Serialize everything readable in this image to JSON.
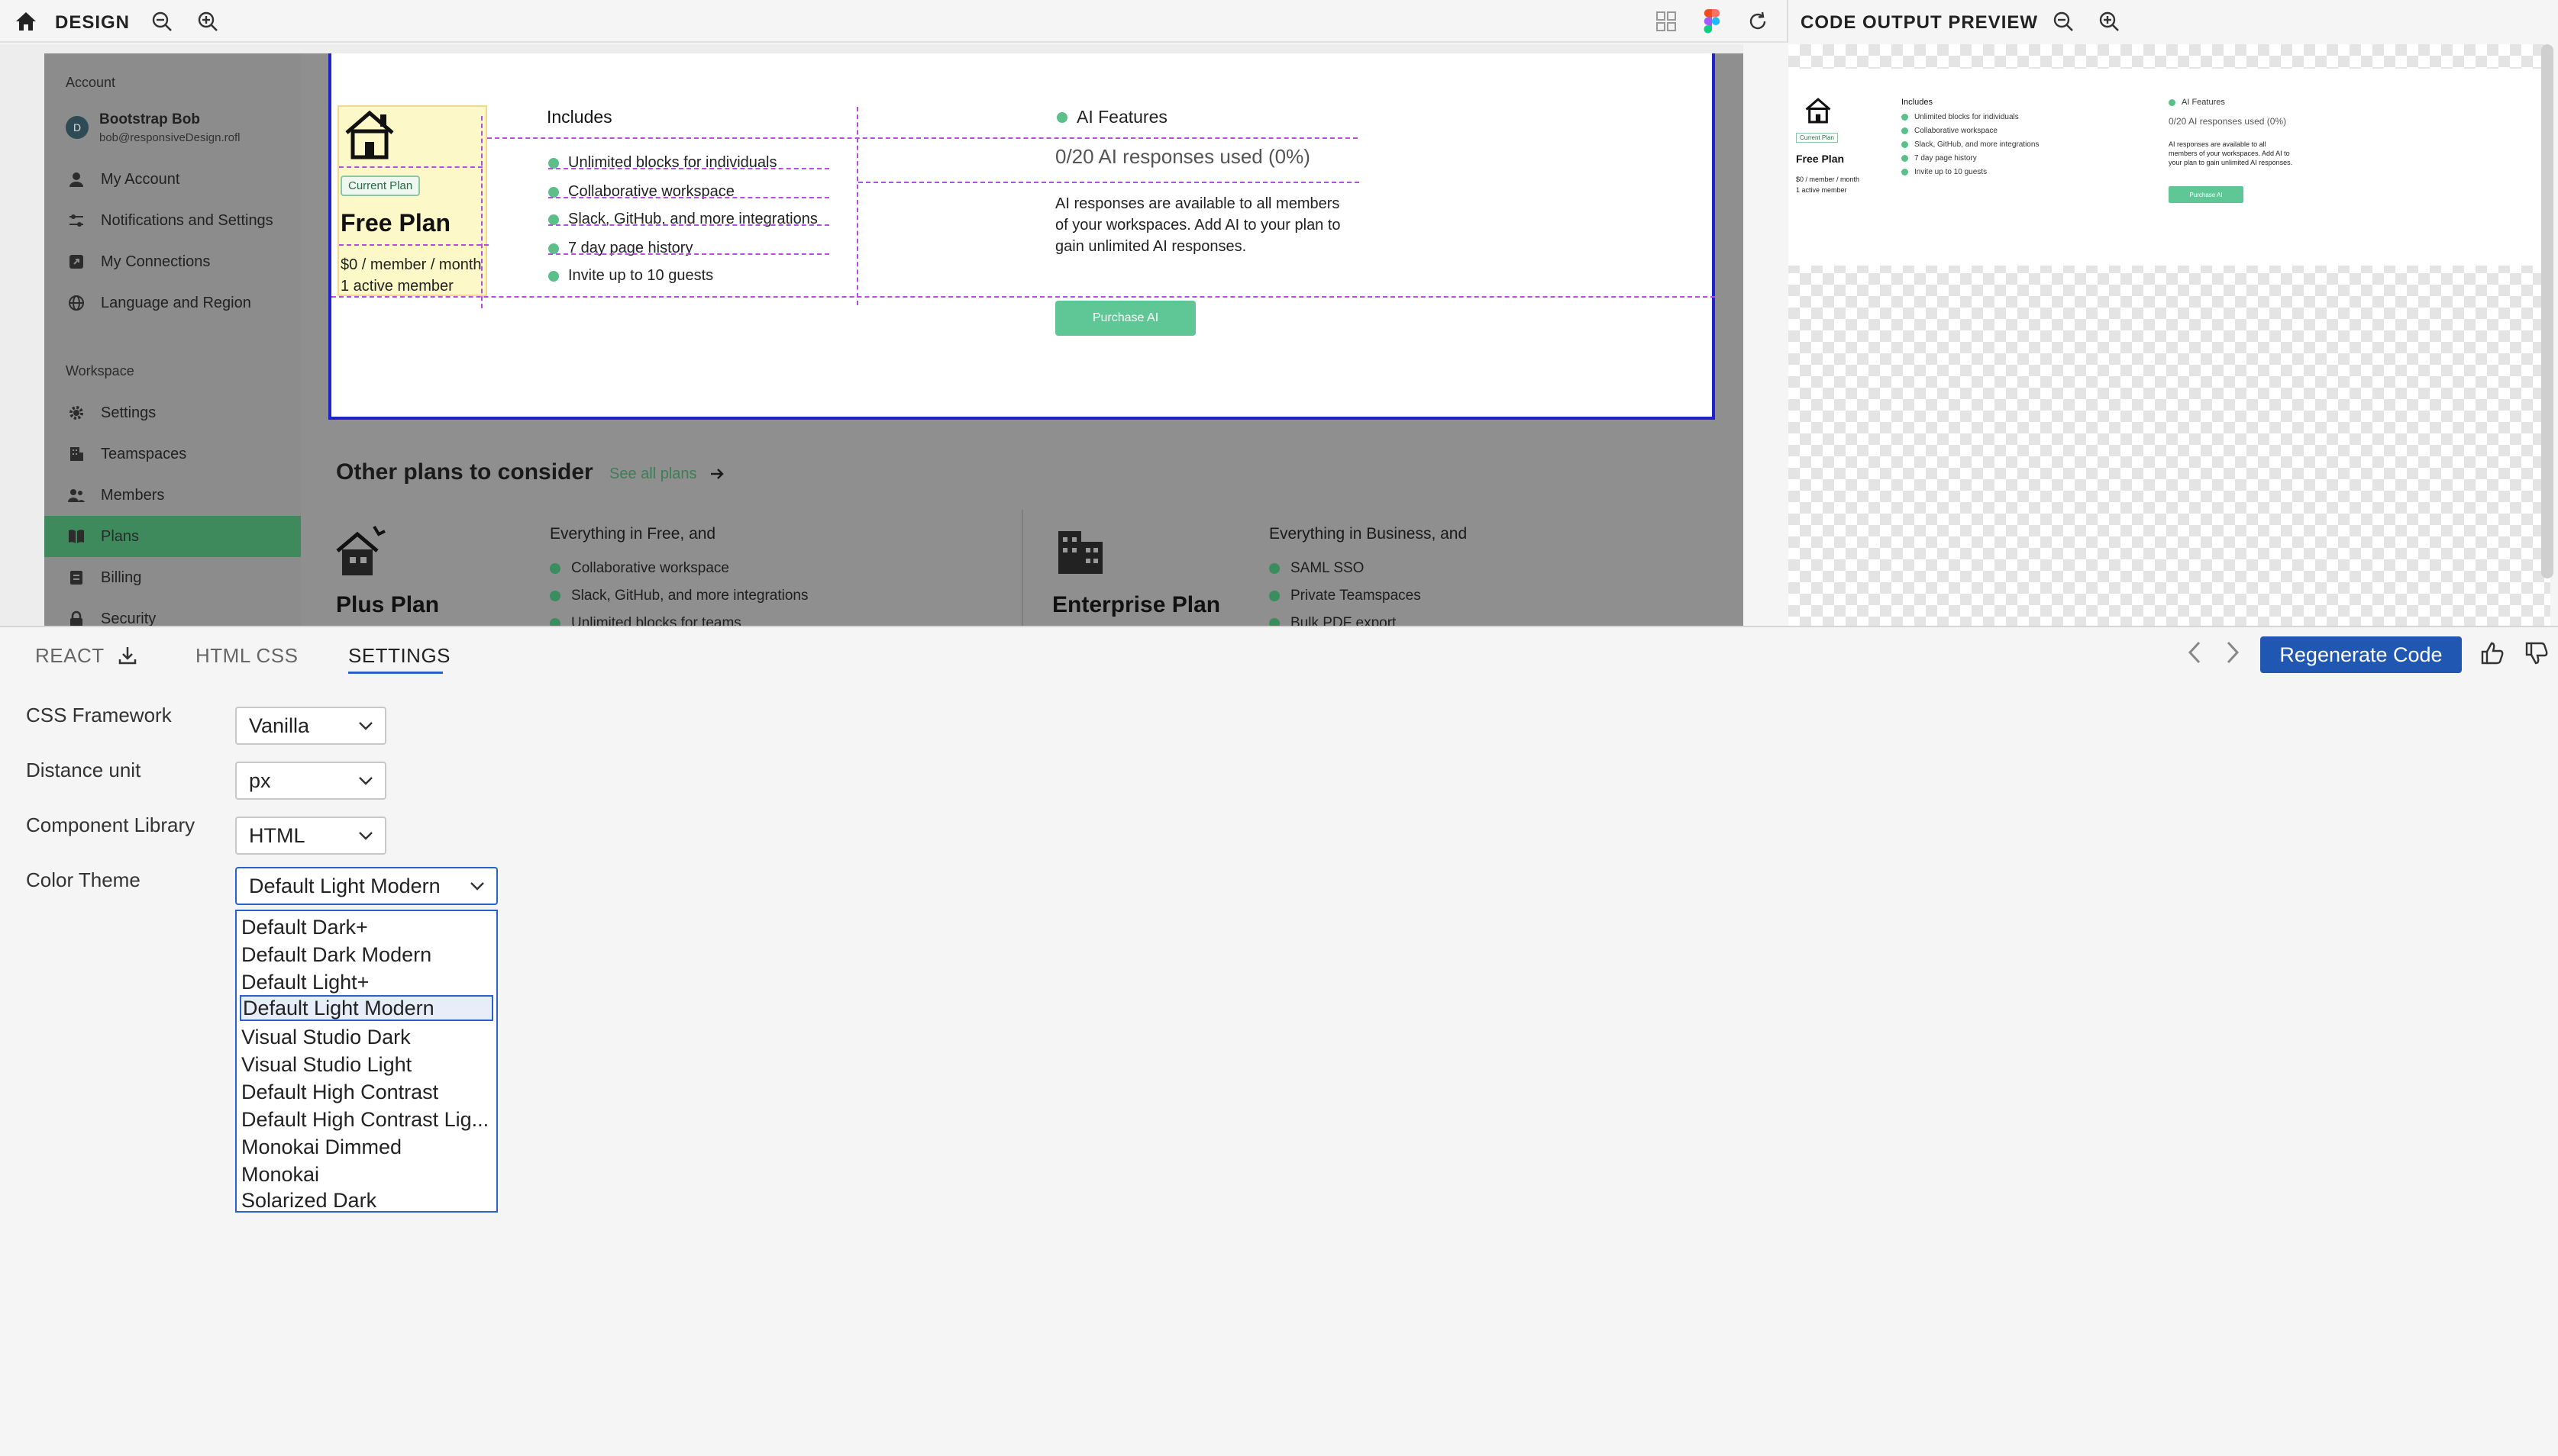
{
  "topbar": {
    "title": "DESIGN",
    "preview_title": "CODE OUTPUT PREVIEW"
  },
  "sidebar": {
    "account_section": "Account",
    "user_name": "Bootstrap Bob",
    "user_email": "bob@responsiveDesign.rofl",
    "avatar_initial": "D",
    "account_items": [
      {
        "label": "My Account",
        "icon": "user-icon"
      },
      {
        "label": "Notifications and Settings",
        "icon": "sliders-icon"
      },
      {
        "label": "My Connections",
        "icon": "link-out-icon"
      },
      {
        "label": "Language and Region",
        "icon": "globe-icon"
      }
    ],
    "workspace_section": "Workspace",
    "workspace_items": [
      {
        "label": "Settings",
        "icon": "gear-icon"
      },
      {
        "label": "Teamspaces",
        "icon": "building-icon"
      },
      {
        "label": "Members",
        "icon": "users-icon"
      },
      {
        "label": "Plans",
        "icon": "book-icon",
        "active": true
      },
      {
        "label": "Billing",
        "icon": "receipt-icon"
      },
      {
        "label": "Security",
        "icon": "lock-icon"
      }
    ]
  },
  "current_plan": {
    "badge": "Current Plan",
    "name": "Free Plan",
    "price": "$0 / member / month",
    "members": "1 active member",
    "includes_title": "Includes",
    "includes": [
      "Unlimited blocks for individuals",
      "Collaborative workspace",
      "Slack, GitHub, and more integrations",
      "7 day page history",
      "Invite up to 10 guests"
    ],
    "ai_title": "AI Features",
    "ai_usage": "0/20 AI responses used (0%)",
    "ai_desc_1": "AI responses are available to all members",
    "ai_desc_2": "of your workspaces. Add AI to your plan to",
    "ai_desc_3": "gain unlimited AI responses.",
    "purchase_label": "Purchase AI"
  },
  "other_plans": {
    "title": "Other plans to consider",
    "see_all": "See all plans",
    "plus": {
      "name": "Plus Plan",
      "heading": "Everything in Free, and",
      "items": [
        "Collaborative workspace",
        "Slack, GitHub, and more integrations",
        "Unlimited blocks for teams"
      ]
    },
    "enterprise": {
      "name": "Enterprise Plan",
      "heading": "Everything in Business, and",
      "items": [
        "SAML SSO",
        "Private Teamspaces",
        "Bulk PDF export"
      ]
    }
  },
  "preview": {
    "badge": "Current Plan",
    "name": "Free Plan",
    "price": "$0 / member / month",
    "members": "1 active member",
    "includes_title": "Includes",
    "includes": [
      "Unlimited blocks for individuals",
      "Collaborative workspace",
      "Slack, GitHub, and more integrations",
      "7 day page history",
      "Invite up to 10 guests"
    ],
    "ai_title": "AI Features",
    "ai_usage": "0/20 AI responses used (0%)",
    "ai_desc_1": "AI responses are available to all",
    "ai_desc_2": "members of your workspaces. Add AI to",
    "ai_desc_3": "your plan to gain unlimited AI responses.",
    "purchase_label": "Purchase AI"
  },
  "tabs": [
    {
      "label": "REACT"
    },
    {
      "label": "HTML CSS"
    },
    {
      "label": "SETTINGS",
      "active": true
    }
  ],
  "actions": {
    "regenerate_label": "Regenerate Code"
  },
  "settings": {
    "css_framework": {
      "label": "CSS Framework",
      "value": "Vanilla"
    },
    "distance_unit": {
      "label": "Distance unit",
      "value": "px"
    },
    "component_library": {
      "label": "Component Library",
      "value": "HTML"
    },
    "color_theme": {
      "label": "Color Theme",
      "value": "Default Light Modern",
      "options": [
        "Default Dark+",
        "Default Dark Modern",
        "Default Light+",
        "Default Light Modern",
        "Visual Studio Dark",
        "Visual Studio Light",
        "Default High Contrast",
        "Default High Contrast Lig...",
        "Monokai Dimmed",
        "Monokai",
        "Solarized Dark"
      ]
    }
  },
  "colors": {
    "accent_green": "#5bbf8a",
    "selection_blue": "#2a62c9",
    "regenerate_bg": "#1f57b3",
    "active_sidebar": "#3f8a5c"
  }
}
